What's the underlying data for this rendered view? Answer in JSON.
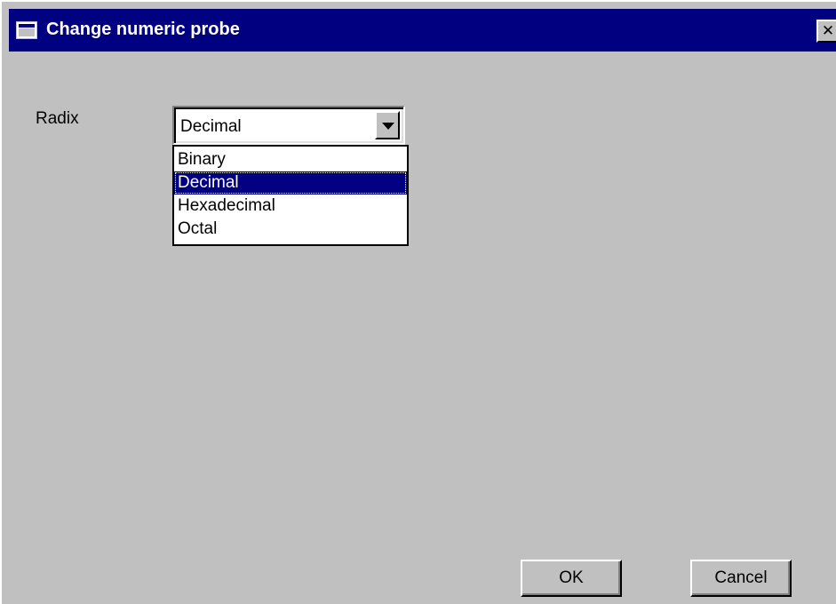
{
  "window": {
    "title": "Change numeric probe",
    "close_glyph": "✕"
  },
  "radix": {
    "label": "Radix",
    "selected": "Decimal",
    "options": [
      "Binary",
      "Decimal",
      "Hexadecimal",
      "Octal"
    ],
    "highlighted_option": "Decimal"
  },
  "buttons": {
    "ok_label": "OK",
    "cancel_label": "Cancel"
  },
  "colors": {
    "titlebar": "#000080",
    "dialog_bg": "#c0c0c0",
    "selection": "#000080"
  },
  "icons": {
    "window": "window-icon",
    "close": "close-icon",
    "dropdown": "chevron-down-icon"
  }
}
